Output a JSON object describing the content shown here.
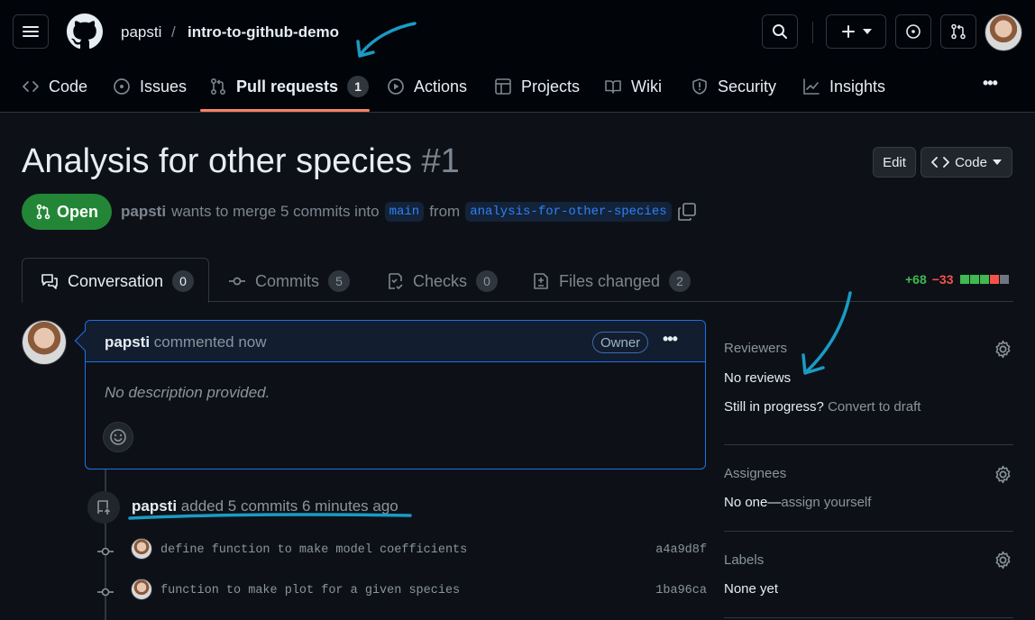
{
  "header": {
    "owner": "papsti",
    "separator": "/",
    "repo": "intro-to-github-demo"
  },
  "nav": {
    "code": "Code",
    "issues": "Issues",
    "pull_requests": "Pull requests",
    "pull_requests_count": "1",
    "actions": "Actions",
    "projects": "Projects",
    "wiki": "Wiki",
    "security": "Security",
    "insights": "Insights",
    "more": "•••"
  },
  "pr": {
    "title": "Analysis for other species",
    "number": "#1",
    "edit_label": "Edit",
    "code_label": "Code",
    "state": "Open",
    "author": "papsti",
    "merge_text": "wants to merge 5 commits into",
    "base_branch": "main",
    "from_text": "from",
    "head_branch": "analysis-for-other-species"
  },
  "tabs": {
    "conversation": "Conversation",
    "conversation_count": "0",
    "commits": "Commits",
    "commits_count": "5",
    "checks": "Checks",
    "checks_count": "0",
    "files": "Files changed",
    "files_count": "2"
  },
  "diffstat": {
    "additions": "+68",
    "deletions": "−33",
    "colors": [
      "#3fb950",
      "#3fb950",
      "#3fb950",
      "#f85149",
      "#6e7681"
    ]
  },
  "comment": {
    "author": "papsti",
    "action": "commented now",
    "badge": "Owner",
    "body": "No description provided."
  },
  "timeline": {
    "author": "papsti",
    "action": "added 5 commits 6 minutes ago",
    "commits": [
      {
        "message": "define function to make model coefficients",
        "sha": "a4a9d8f"
      },
      {
        "message": "function to make plot for a given species",
        "sha": "1ba96ca"
      }
    ]
  },
  "sidebar": {
    "reviewers_label": "Reviewers",
    "reviewers_value": "No reviews",
    "in_progress": "Still in progress?",
    "convert_draft": "Convert to draft",
    "assignees_label": "Assignees",
    "assignees_value": "No one—",
    "assign_yourself": "assign yourself",
    "labels_label": "Labels",
    "labels_value": "None yet"
  },
  "colors": {
    "accent": "#2f81f7",
    "open_green": "#238636",
    "selected_underline": "#f78166",
    "annotation": "#1a9bc4"
  }
}
